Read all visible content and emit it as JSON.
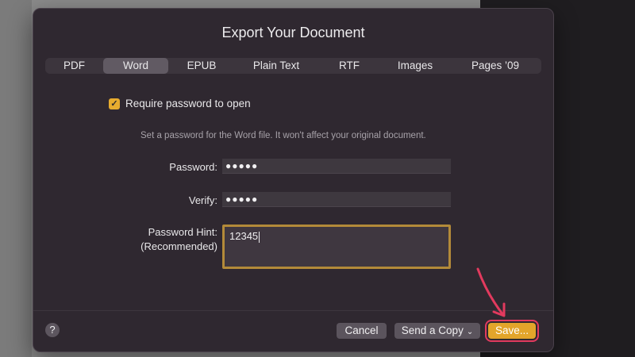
{
  "dialog": {
    "title": "Export Your Document",
    "tabs": [
      {
        "label": "PDF",
        "selected": false
      },
      {
        "label": "Word",
        "selected": true
      },
      {
        "label": "EPUB",
        "selected": false
      },
      {
        "label": "Plain Text",
        "selected": false
      },
      {
        "label": "RTF",
        "selected": false
      },
      {
        "label": "Images",
        "selected": false
      },
      {
        "label": "Pages ’09",
        "selected": false
      }
    ],
    "require_password": {
      "label": "Require password to open",
      "checked": true
    },
    "info_text": "Set a password for the Word file. It won't affect your original document.",
    "password": {
      "label": "Password:",
      "value": "●●●●●"
    },
    "verify": {
      "label": "Verify:",
      "value": "●●●●●"
    },
    "hint": {
      "label_line1": "Password Hint:",
      "label_line2": "(Recommended)",
      "value": "12345"
    },
    "buttons": {
      "help": "?",
      "cancel": "Cancel",
      "send_copy": "Send a Copy",
      "save": "Save..."
    }
  },
  "colors": {
    "accent": "#e2a52a",
    "highlight": "#e23a5e",
    "dialog_bg": "#2f2830"
  }
}
